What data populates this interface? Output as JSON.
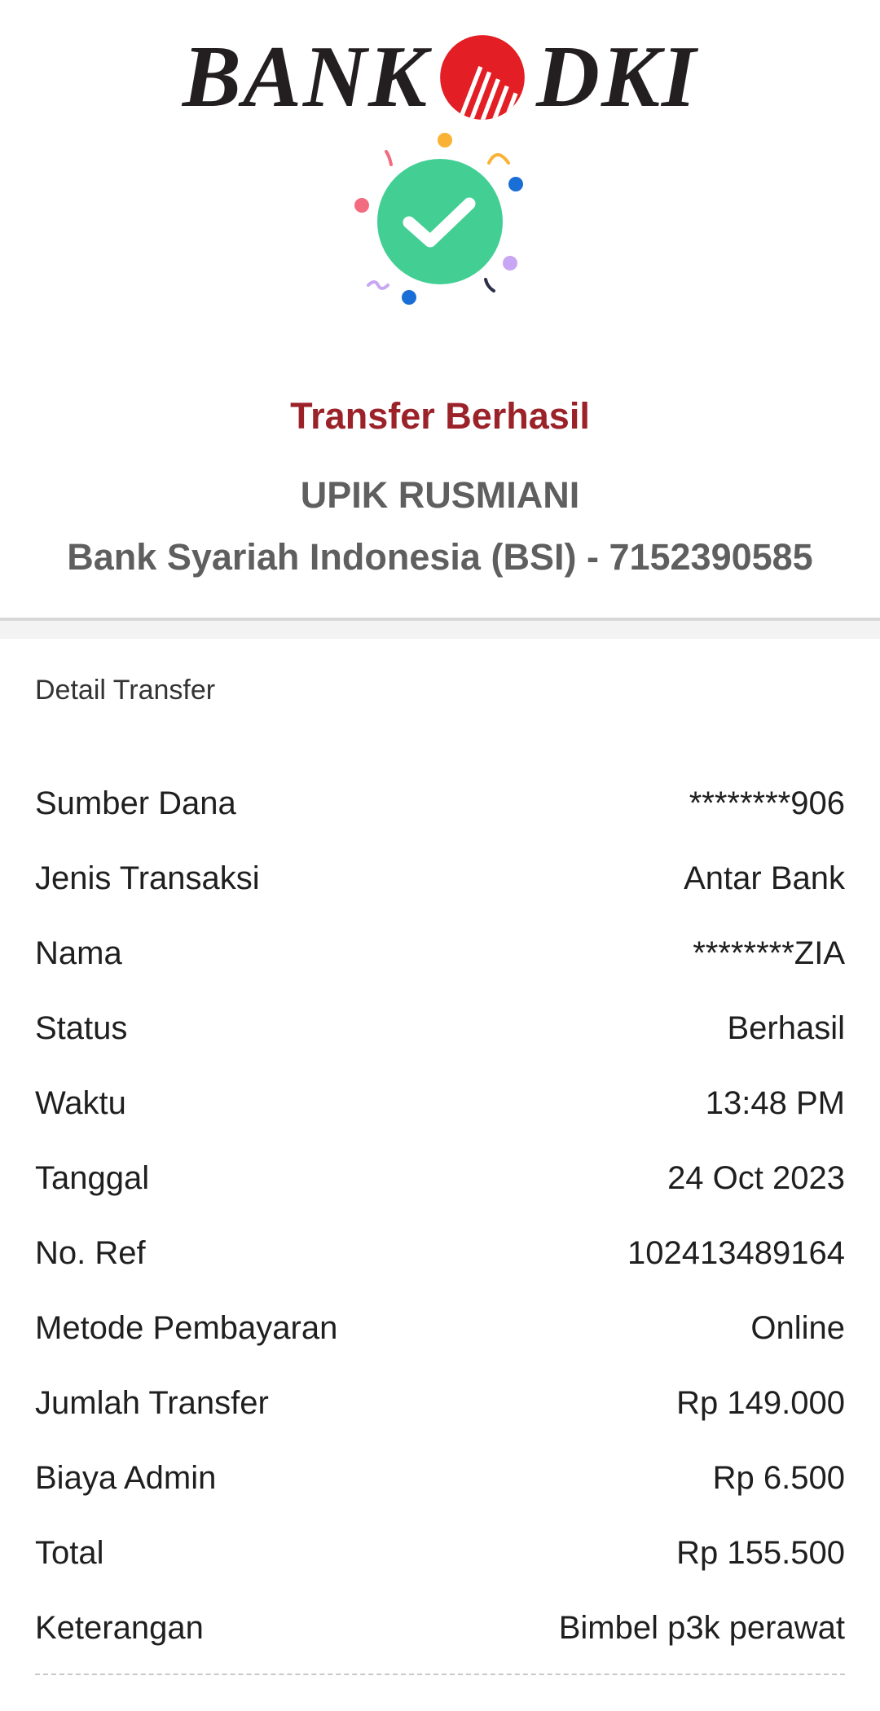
{
  "brand": {
    "name_left": "BANK",
    "name_right": "DKI",
    "logo_red": "#e31e24"
  },
  "icons": {
    "logo_mark": "bank-dki-logo-icon",
    "success": "check-circle-icon"
  },
  "colors": {
    "success_green": "#43cf94",
    "title_red": "#9b2229",
    "muted_text": "#5f5f5f"
  },
  "header": {
    "status": "Transfer Berhasil",
    "recipient_name": "UPIK RUSMIANI",
    "recipient_bank": "Bank Syariah Indonesia (BSI) - 7152390585"
  },
  "detail": {
    "title": "Detail Transfer",
    "rows": [
      {
        "label": "Sumber Dana",
        "value": "********906"
      },
      {
        "label": "Jenis Transaksi",
        "value": "Antar Bank"
      },
      {
        "label": "Nama",
        "value": "********ZIA"
      },
      {
        "label": "Status",
        "value": "Berhasil"
      },
      {
        "label": "Waktu",
        "value": "13:48 PM"
      },
      {
        "label": "Tanggal",
        "value": "24 Oct 2023"
      },
      {
        "label": "No. Ref",
        "value": "102413489164"
      },
      {
        "label": "Metode Pembayaran",
        "value": "Online"
      },
      {
        "label": "Jumlah Transfer",
        "value": "Rp 149.000"
      },
      {
        "label": "Biaya Admin",
        "value": "Rp 6.500"
      },
      {
        "label": "Total",
        "value": "Rp 155.500"
      },
      {
        "label": "Keterangan",
        "value": "Bimbel p3k perawat"
      }
    ]
  }
}
